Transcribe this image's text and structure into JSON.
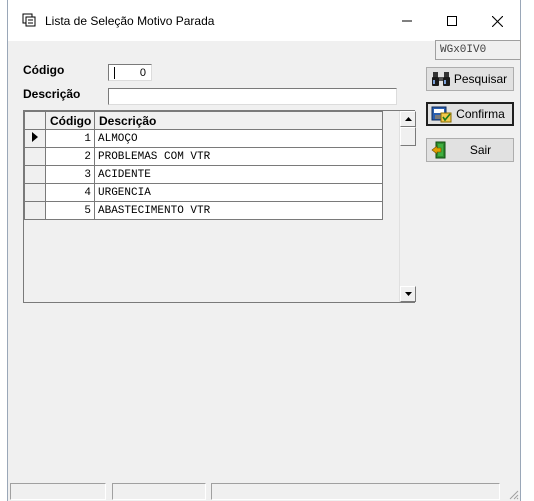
{
  "window": {
    "title": "Lista de Seleção Motivo Parada",
    "form_id": "WGx0IV0"
  },
  "filters": {
    "codigo_label": "Código",
    "codigo_value": "0",
    "descricao_label": "Descrição",
    "descricao_value": ""
  },
  "grid": {
    "columns": [
      "Código",
      "Descrição"
    ],
    "rows": [
      {
        "codigo": "1",
        "descricao": "ALMOÇO",
        "current": true
      },
      {
        "codigo": "2",
        "descricao": "PROBLEMAS COM VTR",
        "current": false
      },
      {
        "codigo": "3",
        "descricao": "ACIDENTE",
        "current": false
      },
      {
        "codigo": "4",
        "descricao": "URGENCIA",
        "current": false
      },
      {
        "codigo": "5",
        "descricao": "ABASTECIMENTO VTR",
        "current": false
      }
    ]
  },
  "buttons": {
    "pesquisar": "Pesquisar",
    "confirma": "Confirma",
    "sair": "Sair"
  },
  "icons": {
    "app": "form-icon",
    "pesquisar": "binoculars-icon",
    "confirma": "confirm-icon",
    "sair": "exit-door-icon"
  }
}
